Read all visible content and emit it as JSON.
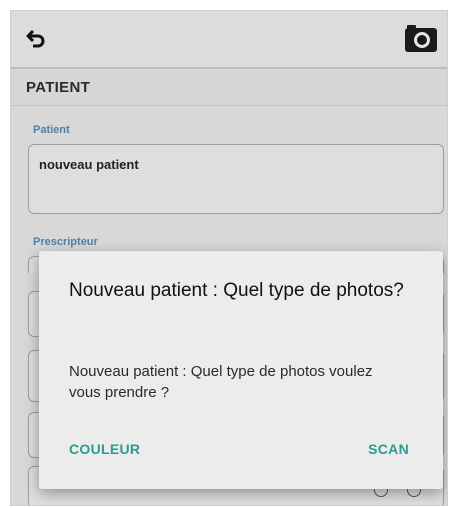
{
  "header": {
    "back_icon": "undo-arrow-icon",
    "camera_icon": "camera-icon"
  },
  "section": {
    "title": "PATIENT"
  },
  "form": {
    "patient_label": "Patient",
    "patient_value": "nouveau patient",
    "prescriber_label": "Prescripteur"
  },
  "dialog": {
    "title": "Nouveau patient : Quel type de photos?",
    "message": "Nouveau patient : Quel type de photos voulez vous prendre ?",
    "button_color": "COULEUR",
    "button_scan": "SCAN",
    "accent_color": "#2a9d8f"
  }
}
